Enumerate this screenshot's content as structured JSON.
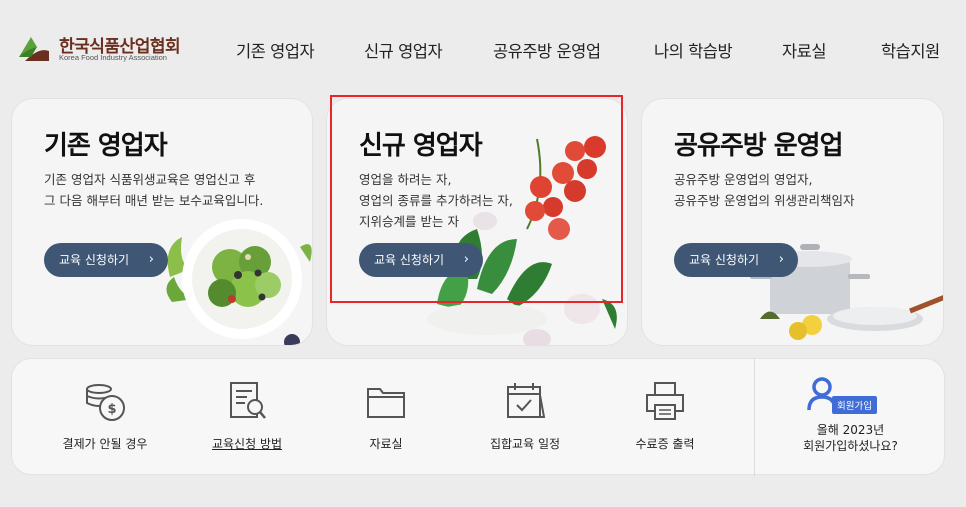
{
  "header": {
    "logo_ko": "한국식품산업협회",
    "logo_en": "Korea Food Industry Association",
    "nav": [
      "기존 영업자",
      "신규 영업자",
      "공유주방 운영업",
      "나의 학습방",
      "자료실",
      "학습지원"
    ]
  },
  "cards": [
    {
      "title": "기존 영업자",
      "desc": [
        "기존 영업자 식품위생교육은 영업신고 후",
        "그 다음 해부터 매년 받는 보수교육입니다."
      ],
      "button": "교육 신청하기"
    },
    {
      "title": "신규 영업자",
      "desc": [
        "영업을 하려는 자,",
        "영업의 종류를 추가하려는 자,",
        "지위승계를 받는 자"
      ],
      "button": "교육 신청하기"
    },
    {
      "title": "공유주방 운영업",
      "desc": [
        "공유주방 운영업의 영업자,",
        "공유주방 운영업의 위생관리책임자"
      ],
      "button": "교육 신청하기"
    }
  ],
  "quick_links": [
    {
      "label": "결제가 안될 경우",
      "icon": "coin-payment-icon"
    },
    {
      "label": "교육신청 방법",
      "icon": "document-search-icon"
    },
    {
      "label": "자료실",
      "icon": "folder-icon"
    },
    {
      "label": "집합교육 일정",
      "icon": "calendar-check-icon"
    },
    {
      "label": "수료증 출력",
      "icon": "printer-icon"
    }
  ],
  "member": {
    "badge": "회원가입",
    "line1": "올해 2023년",
    "line2": "회원가입하셨나요?"
  },
  "colors": {
    "button": "#3f5775",
    "logo_text": "#6b2f1f",
    "badge": "#3f6cd6",
    "highlight_box": "#e8262a"
  }
}
